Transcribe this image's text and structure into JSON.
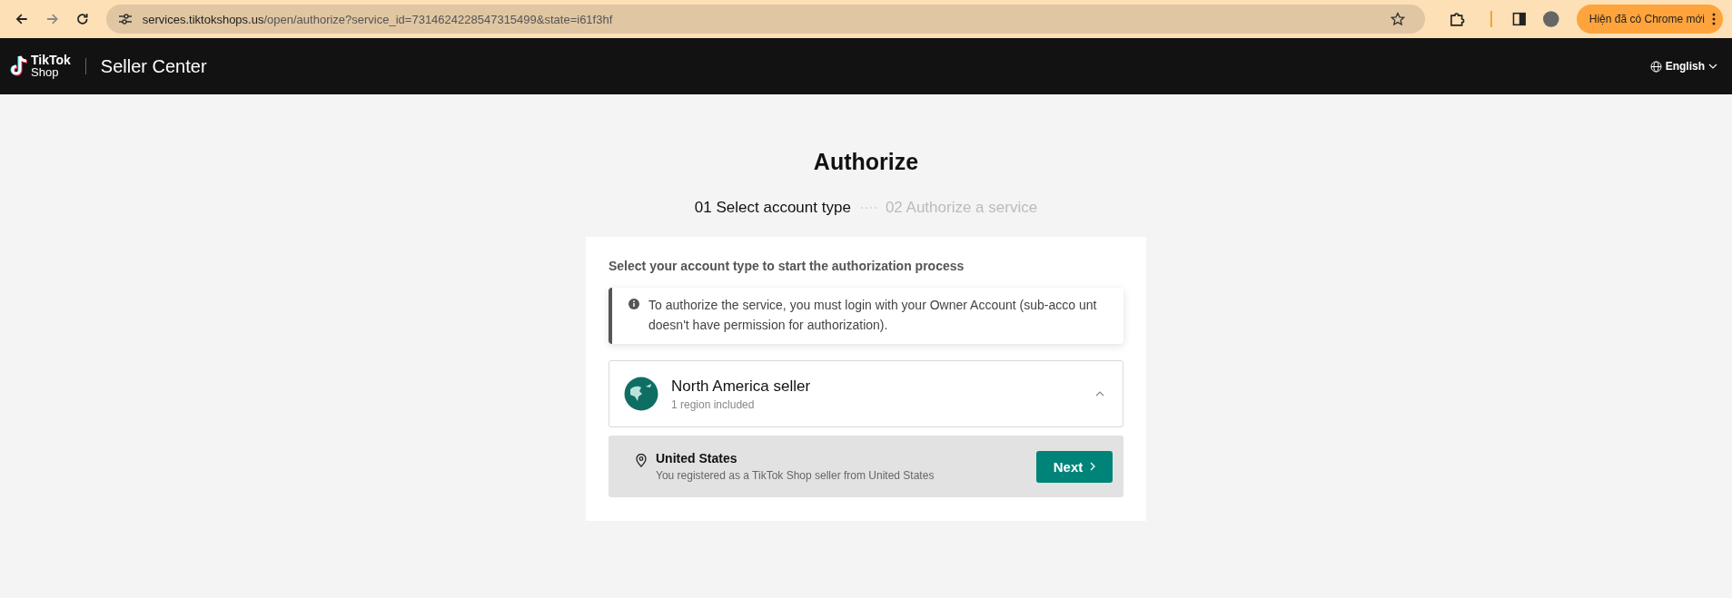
{
  "browser": {
    "url_host": "services.tiktokshops.us",
    "url_path": "/open/authorize?service_id=7314624228547315499&state=i61f3hf",
    "update_button": "Hiện đã có Chrome mới"
  },
  "header": {
    "logo_top": "TikTok",
    "logo_bottom": "Shop",
    "product": "Seller Center",
    "language": "English"
  },
  "page": {
    "title": "Authorize",
    "steps": [
      {
        "label": "01 Select account type",
        "selected": true
      },
      {
        "label": "02 Authorize a service",
        "selected": false
      }
    ],
    "prompt": "Select your account type to start the authorization process",
    "notice": "To authorize the service, you must login with your Owner Account (sub-acco unt doesn't have permission for authorization).",
    "account_type": {
      "name": "North America seller",
      "subtitle": "1 region included",
      "expanded": true,
      "regions": [
        {
          "name": "United States",
          "description": "You registered as a TikTok Shop seller from United States",
          "button": "Next"
        }
      ]
    }
  }
}
